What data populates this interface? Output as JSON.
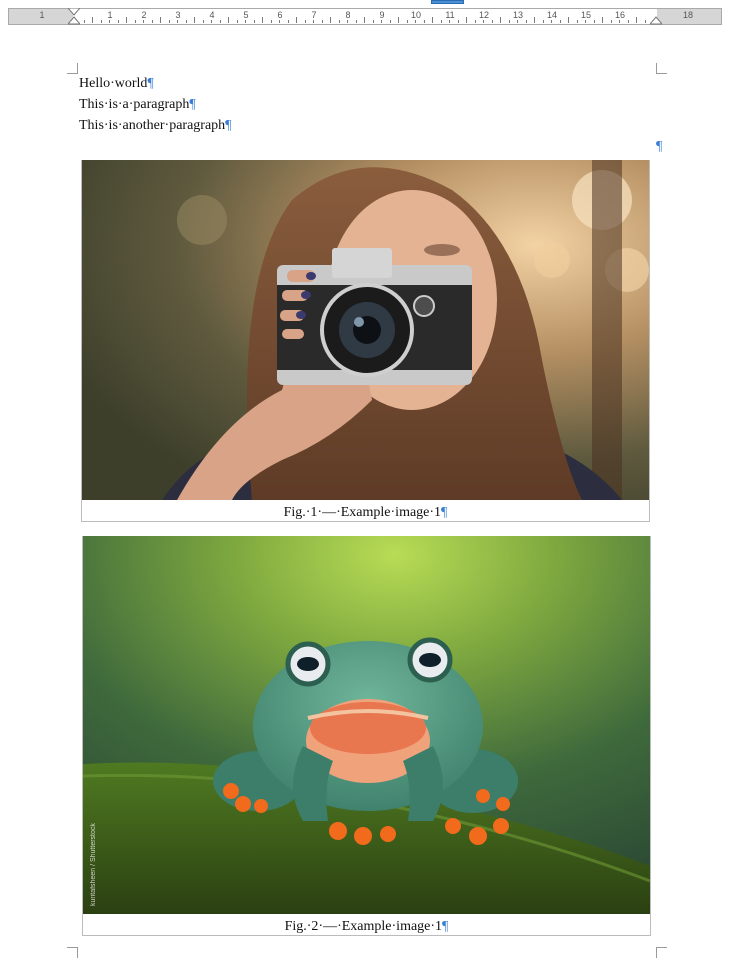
{
  "ruler": {
    "numbers": [
      "1",
      "1",
      "2",
      "3",
      "4",
      "5",
      "6",
      "7",
      "8",
      "9",
      "10",
      "11",
      "12",
      "13",
      "14",
      "15",
      "16",
      "18"
    ]
  },
  "document": {
    "paragraphs": [
      "Hello world",
      "This is a paragraph",
      "This is another paragraph"
    ],
    "pilcrow": "¶",
    "space_mark": "·",
    "figures": [
      {
        "subject": "woman photographing with vintage camera",
        "caption": "Fig.·1·—·Example·image·1"
      },
      {
        "subject": "green tree frog smiling on moss",
        "watermark": "kuritafsheen / Shutterstock",
        "caption": "Fig.·2·—·Example·image·1"
      }
    ]
  },
  "colors": {
    "formatting_mark": "#3a7fd5",
    "accent": "#4a90d9"
  }
}
